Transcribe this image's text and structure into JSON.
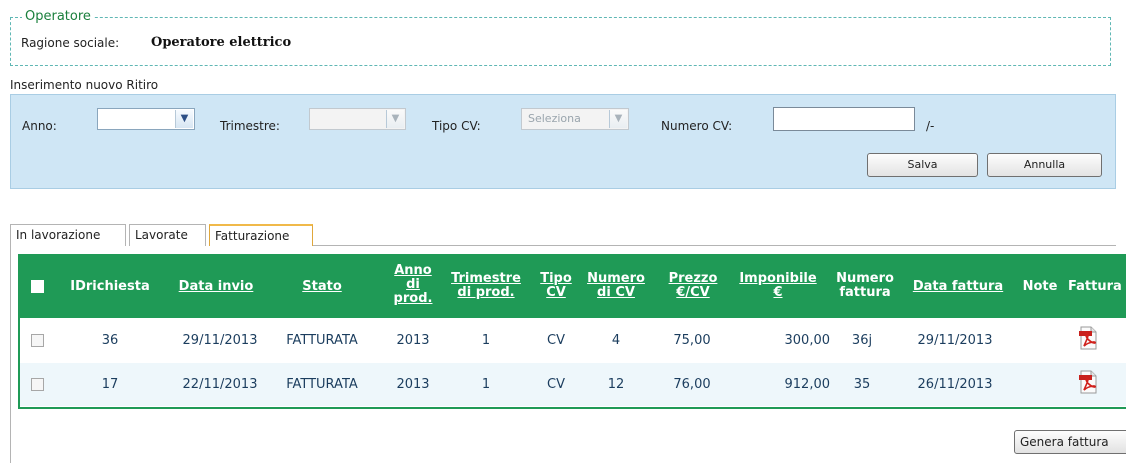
{
  "operatore": {
    "legend": "Operatore",
    "ragione_sociale_label": "Ragione sociale:",
    "ragione_sociale_value": "Operatore elettrico"
  },
  "inserimento": {
    "title": "Inserimento nuovo Ritiro",
    "anno_label": "Anno:",
    "anno_value": "",
    "trimestre_label": "Trimestre:",
    "trimestre_value": "",
    "tipo_cv_label": "Tipo CV:",
    "tipo_cv_value": "Seleziona",
    "numero_cv_label": "Numero CV:",
    "numero_cv_value": "",
    "numero_cv_suffix": "/-",
    "salva_label": "Salva",
    "annulla_label": "Annulla"
  },
  "tabs": [
    {
      "label": "In lavorazione",
      "active": false
    },
    {
      "label": "Lavorate",
      "active": false
    },
    {
      "label": "Fatturazione",
      "active": true
    }
  ],
  "table": {
    "headers": {
      "idrichiesta": "IDrichiesta",
      "data_invio": "Data invio",
      "stato": "Stato",
      "anno_l1": "Anno",
      "anno_l2": "di",
      "anno_l3": "prod.",
      "trimestre_l1": "Trimestre",
      "trimestre_l2": "di prod.",
      "tipo_l1": "Tipo",
      "tipo_l2": "CV",
      "numero_l1": "Numero",
      "numero_l2": "di CV",
      "prezzo_l1": "Prezzo",
      "prezzo_l2": "€/CV",
      "imponibile_l1": "Imponibile",
      "imponibile_l2": "€",
      "numfatt_l1": "Numero",
      "numfatt_l2": "fattura",
      "data_fattura": "Data fattura",
      "note": "Note",
      "fattura": "Fattura"
    },
    "rows": [
      {
        "id": "36",
        "data_invio": "29/11/2013",
        "stato": "FATTURATA",
        "anno": "2013",
        "trimestre": "1",
        "tipo": "CV",
        "numero": "4",
        "prezzo": "75,00",
        "imponibile": "300,00",
        "num_fattura": "36j",
        "data_fattura": "29/11/2013",
        "note": ""
      },
      {
        "id": "17",
        "data_invio": "22/11/2013",
        "stato": "FATTURATA",
        "anno": "2013",
        "trimestre": "1",
        "tipo": "CV",
        "numero": "12",
        "prezzo": "76,00",
        "imponibile": "912,00",
        "num_fattura": "35",
        "data_fattura": "26/11/2013",
        "note": ""
      }
    ]
  },
  "genera_fattura_label": "Genera fattura",
  "colors": {
    "header_green": "#1f9a56",
    "panel_blue": "#cfe6f5",
    "legend_green": "#1a7f3c",
    "cell_text": "#1b3d5e"
  }
}
